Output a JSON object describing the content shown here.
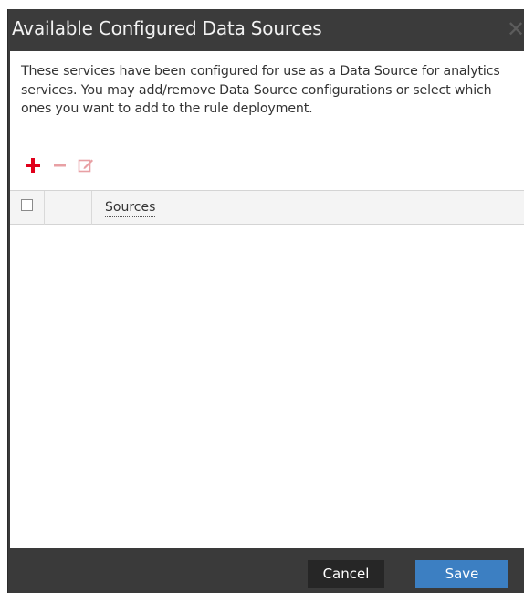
{
  "dialog": {
    "title": "Available Configured Data Sources",
    "close_symbol": "✕",
    "description": "These services have been configured for use as a Data Source for analytics services. You may add/remove Data Source configurations or select which ones you want to add to the rule deployment."
  },
  "toolbar": {
    "add_icon": "plus-icon",
    "remove_icon": "minus-icon",
    "edit_icon": "edit-icon"
  },
  "table": {
    "columns": [
      "",
      "",
      "Sources"
    ],
    "rows": []
  },
  "footer": {
    "cancel_label": "Cancel",
    "save_label": "Save"
  },
  "colors": {
    "titlebar": "#3b3b3b",
    "add_icon": "#e0001b",
    "disabled_icon": "#e8a0a4",
    "save_button": "#3c7fc2",
    "cancel_button": "#262626"
  }
}
